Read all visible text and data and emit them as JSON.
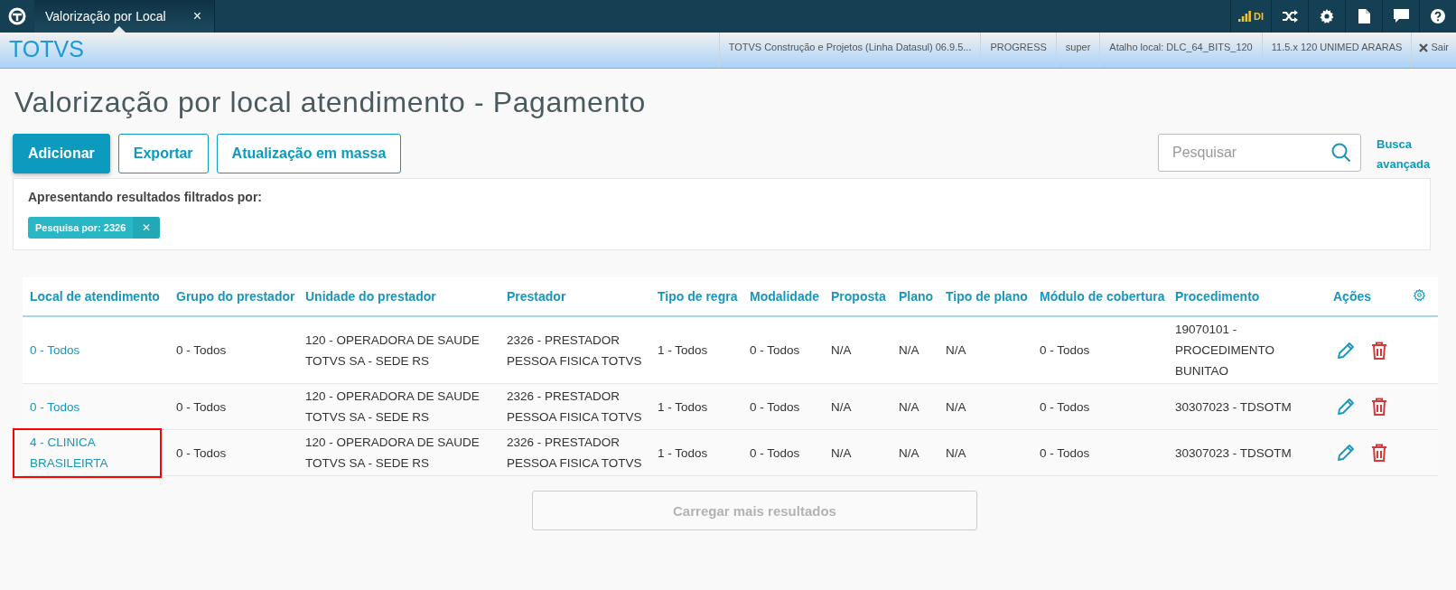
{
  "topbar": {
    "tab": {
      "title": "Valorização por Local",
      "close": "×"
    },
    "signal_label": "DI"
  },
  "header": {
    "brand": "TOTVS",
    "info": [
      "TOTVS Construção e Projetos (Linha Datasul) 06.9.5...",
      "PROGRESS",
      "super",
      "Atalho local: DLC_64_BITS_120",
      "11.5.x 120 UNIMED ARARAS"
    ],
    "logout": "Sair"
  },
  "page": {
    "title": "Valorização por local atendimento - Pagamento",
    "actions": [
      {
        "label": "Adicionar",
        "kind": "primary"
      },
      {
        "label": "Exportar",
        "kind": "secondary"
      },
      {
        "label": "Atualização em massa",
        "kind": "secondary"
      }
    ],
    "search": {
      "placeholder": "Pesquisar"
    },
    "advanced_search": "Busca avançada",
    "filter": {
      "caption": "Apresentando resultados filtrados por:",
      "tags": [
        {
          "label": "Pesquisa por: 2326",
          "remove": "✕"
        }
      ]
    }
  },
  "table": {
    "columns": [
      "Local de atendimento",
      "Grupo do prestador",
      "Unidade do prestador",
      "Prestador",
      "Tipo de regra",
      "Modalidade",
      "Proposta",
      "Plano",
      "Tipo de plano",
      "Módulo de cobertura",
      "Procedimento",
      "Ações"
    ],
    "rows": [
      {
        "highlighted": false,
        "cells": [
          "0 - Todos",
          "0 - Todos",
          "120 - OPERADORA DE SAUDE TOTVS SA - SEDE RS",
          "2326 - PRESTADOR PESSOA FISICA TOTVS",
          "1 - Todos",
          "0 - Todos",
          "N/A",
          "N/A",
          "N/A",
          "0 - Todos",
          "19070101 - PROCEDIMENTO BUNITAO"
        ]
      },
      {
        "highlighted": false,
        "cells": [
          "0 - Todos",
          "0 - Todos",
          "120 - OPERADORA DE SAUDE TOTVS SA - SEDE RS",
          "2326 - PRESTADOR PESSOA FISICA TOTVS",
          "1 - Todos",
          "0 - Todos",
          "N/A",
          "N/A",
          "N/A",
          "0 - Todos",
          "30307023 - TDSOTM"
        ]
      },
      {
        "highlighted": true,
        "cells": [
          "4 - CLINICA BRASILEIRTA",
          "0 - Todos",
          "120 - OPERADORA DE SAUDE TOTVS SA - SEDE RS",
          "2326 - PRESTADOR PESSOA FISICA TOTVS",
          "1 - Todos",
          "0 - Todos",
          "N/A",
          "N/A",
          "N/A",
          "0 - Todos",
          "30307023 - TDSOTM"
        ]
      }
    ],
    "load_more": {
      "label": "Carregar mais resultados",
      "disabled": true
    }
  }
}
